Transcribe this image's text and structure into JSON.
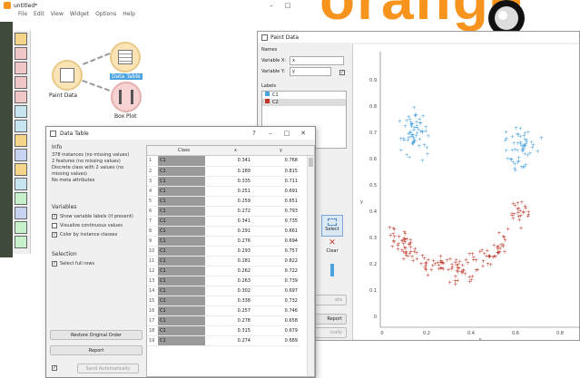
{
  "main_window": {
    "title": "untitled*",
    "menu": [
      "File",
      "Edit",
      "View",
      "Widget",
      "Options",
      "Help"
    ]
  },
  "canvas": {
    "nodes": {
      "paint_data": "Paint Data",
      "data_table": "Data Table",
      "box_plot": "Box Plot"
    }
  },
  "logo_text": "orange",
  "paint_window": {
    "title": "Paint Data",
    "names_group": "Names",
    "var_x_label": "Variable X:",
    "var_x_value": "x",
    "var_y_label": "Variable Y:",
    "var_y_value": "y",
    "labels_group": "Labels",
    "labels": [
      {
        "name": "C1",
        "color": "#4aa3df"
      },
      {
        "name": "C2",
        "color": "#c0392b"
      }
    ],
    "tool_select": "Select",
    "tool_clear": "Clear",
    "report": "Report",
    "peek_data": "ata",
    "peek_auto": "ically",
    "plot": {
      "y_ticks": [
        "0.9",
        "0.8",
        "0.7",
        "0.6",
        "0.5",
        "0.4",
        "0.3",
        "0.2",
        "0.1",
        "0"
      ],
      "x_ticks": [
        "0",
        "0.2",
        "0.4",
        "0.6",
        "0.8"
      ],
      "x_label": "x",
      "y_label": "y"
    }
  },
  "table_window": {
    "title": "Data Table",
    "info_group": "Info",
    "info_lines": [
      "378 instances (no missing values)",
      "2 features (no missing values)",
      "Discrete class with 2 values (no",
      "missing values)",
      "No meta attributes"
    ],
    "variables_group": "Variables",
    "opt_show_labels": "Show variable labels (if present)",
    "opt_visualize": "Visualize continuous values",
    "opt_color": "Color by instance classes",
    "selection_group": "Selection",
    "opt_select_rows": "Select full rows",
    "restore_btn": "Restore Original Order",
    "report_btn": "Report",
    "send_btn": "Send Automatically",
    "headers": [
      "Class",
      "x",
      "y"
    ],
    "rows": [
      [
        "1",
        "C1",
        "0.341",
        "0.768"
      ],
      [
        "2",
        "C1",
        "0.289",
        "0.815"
      ],
      [
        "3",
        "C1",
        "0.335",
        "0.711"
      ],
      [
        "4",
        "C1",
        "0.251",
        "0.691"
      ],
      [
        "5",
        "C1",
        "0.259",
        "0.651"
      ],
      [
        "6",
        "C1",
        "0.272",
        "0.793"
      ],
      [
        "7",
        "C1",
        "0.341",
        "0.735"
      ],
      [
        "8",
        "C1",
        "0.291",
        "0.661"
      ],
      [
        "9",
        "C1",
        "0.276",
        "0.694"
      ],
      [
        "10",
        "C1",
        "0.293",
        "0.757"
      ],
      [
        "11",
        "C1",
        "0.281",
        "0.822"
      ],
      [
        "12",
        "C1",
        "0.262",
        "0.722"
      ],
      [
        "13",
        "C1",
        "0.263",
        "0.739"
      ],
      [
        "14",
        "C1",
        "0.302",
        "0.697"
      ],
      [
        "15",
        "C1",
        "0.338",
        "0.732"
      ],
      [
        "16",
        "C1",
        "0.257",
        "0.746"
      ],
      [
        "17",
        "C1",
        "0.278",
        "0.658"
      ],
      [
        "18",
        "C1",
        "0.315",
        "0.679"
      ],
      [
        "19",
        "C1",
        "0.274",
        "0.689"
      ]
    ]
  },
  "colors": {
    "accent": "#4aa3df",
    "orange": "#f7941d",
    "c1": "#4aa3df",
    "c2": "#c0392b"
  }
}
